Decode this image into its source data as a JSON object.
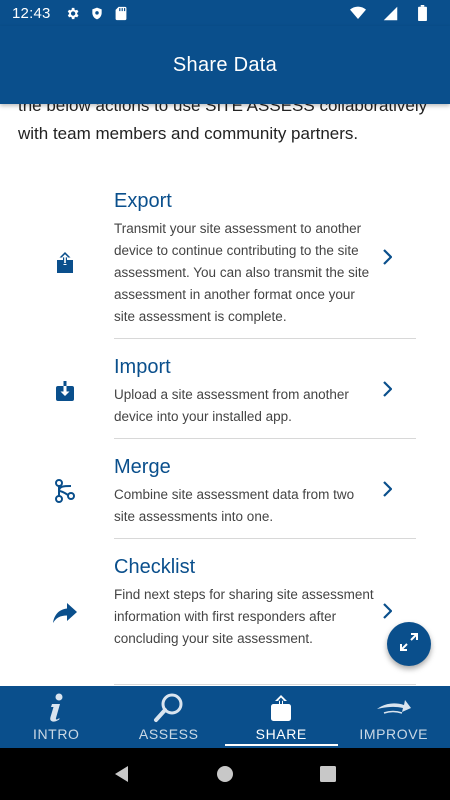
{
  "status_bar": {
    "time": "12:43",
    "icons_left": [
      "gear-icon",
      "shield-icon",
      "sd-card-icon"
    ],
    "icons_right": [
      "wifi-icon",
      "signal-icon",
      "battery-icon"
    ]
  },
  "app_bar": {
    "title": "Share Data"
  },
  "intro": {
    "text": "the below actions to use SITE ASSESS collaboratively with team members and community partners."
  },
  "actions": [
    {
      "icon": "export-icon",
      "title": "Export",
      "description": "Transmit your site assessment to another device to continue contributing to the site assessment. You can also transmit the site assessment in another format once your site assessment is complete."
    },
    {
      "icon": "import-icon",
      "title": "Import",
      "description": "Upload a site assessment from another device into your installed app."
    },
    {
      "icon": "merge-icon",
      "title": "Merge",
      "description": "Combine site assessment data from two site assessments into one."
    },
    {
      "icon": "share-arrow-icon",
      "title": "Checklist",
      "description": "Find next steps for sharing site assessment information with first responders after concluding your site assessment."
    }
  ],
  "fab": {
    "icon": "expand-icon"
  },
  "bottom_nav": {
    "items": [
      {
        "label": "INTRO",
        "icon": "info-icon",
        "active": false
      },
      {
        "label": "ASSESS",
        "icon": "magnifier-icon",
        "active": false
      },
      {
        "label": "SHARE",
        "icon": "share-upload-icon",
        "active": true
      },
      {
        "label": "IMPROVE",
        "icon": "improve-arrow-icon",
        "active": false
      }
    ]
  },
  "system_nav": {
    "buttons": [
      "back-icon",
      "home-icon",
      "recents-icon"
    ]
  },
  "colors": {
    "primary": "#0a4f8c",
    "text": "#222222",
    "divider": "#d8d8d8"
  }
}
